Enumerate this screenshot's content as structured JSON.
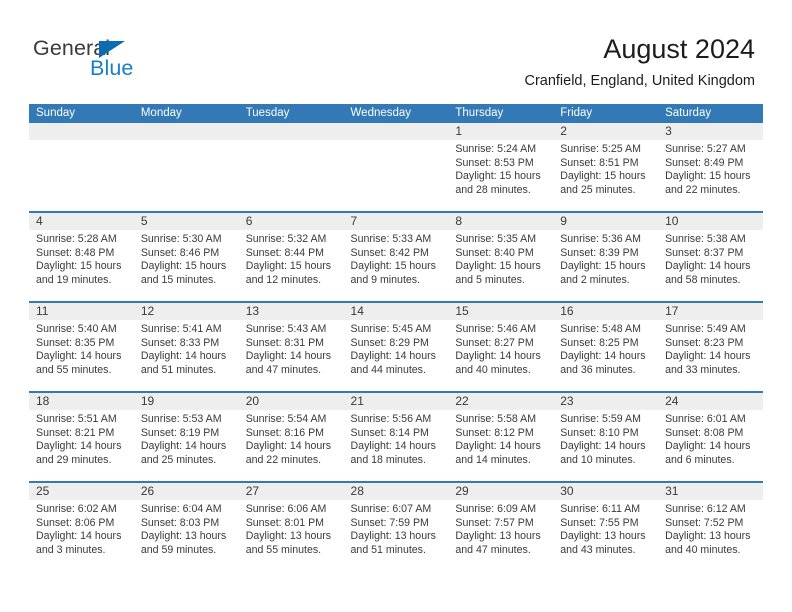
{
  "brand": {
    "name_part1": "General",
    "name_part2": "Blue",
    "triangle_color": "#0b6cb4",
    "blue_color": "#1a7ec8"
  },
  "header": {
    "title": "August 2024",
    "subtitle": "Cranfield, England, United Kingdom"
  },
  "theme": {
    "header_blue": "#3279b5",
    "daynum_band": "#eeeeee",
    "text": "#3a3a3a"
  },
  "weekdays": [
    "Sunday",
    "Monday",
    "Tuesday",
    "Wednesday",
    "Thursday",
    "Friday",
    "Saturday"
  ],
  "weeks": [
    {
      "days": [
        {
          "num": "",
          "sunrise": "",
          "sunset": "",
          "daylight_line1": "",
          "daylight_line2": ""
        },
        {
          "num": "",
          "sunrise": "",
          "sunset": "",
          "daylight_line1": "",
          "daylight_line2": ""
        },
        {
          "num": "",
          "sunrise": "",
          "sunset": "",
          "daylight_line1": "",
          "daylight_line2": ""
        },
        {
          "num": "",
          "sunrise": "",
          "sunset": "",
          "daylight_line1": "",
          "daylight_line2": ""
        },
        {
          "num": "1",
          "sunrise": "Sunrise: 5:24 AM",
          "sunset": "Sunset: 8:53 PM",
          "daylight_line1": "Daylight: 15 hours",
          "daylight_line2": "and 28 minutes."
        },
        {
          "num": "2",
          "sunrise": "Sunrise: 5:25 AM",
          "sunset": "Sunset: 8:51 PM",
          "daylight_line1": "Daylight: 15 hours",
          "daylight_line2": "and 25 minutes."
        },
        {
          "num": "3",
          "sunrise": "Sunrise: 5:27 AM",
          "sunset": "Sunset: 8:49 PM",
          "daylight_line1": "Daylight: 15 hours",
          "daylight_line2": "and 22 minutes."
        }
      ]
    },
    {
      "days": [
        {
          "num": "4",
          "sunrise": "Sunrise: 5:28 AM",
          "sunset": "Sunset: 8:48 PM",
          "daylight_line1": "Daylight: 15 hours",
          "daylight_line2": "and 19 minutes."
        },
        {
          "num": "5",
          "sunrise": "Sunrise: 5:30 AM",
          "sunset": "Sunset: 8:46 PM",
          "daylight_line1": "Daylight: 15 hours",
          "daylight_line2": "and 15 minutes."
        },
        {
          "num": "6",
          "sunrise": "Sunrise: 5:32 AM",
          "sunset": "Sunset: 8:44 PM",
          "daylight_line1": "Daylight: 15 hours",
          "daylight_line2": "and 12 minutes."
        },
        {
          "num": "7",
          "sunrise": "Sunrise: 5:33 AM",
          "sunset": "Sunset: 8:42 PM",
          "daylight_line1": "Daylight: 15 hours",
          "daylight_line2": "and 9 minutes."
        },
        {
          "num": "8",
          "sunrise": "Sunrise: 5:35 AM",
          "sunset": "Sunset: 8:40 PM",
          "daylight_line1": "Daylight: 15 hours",
          "daylight_line2": "and 5 minutes."
        },
        {
          "num": "9",
          "sunrise": "Sunrise: 5:36 AM",
          "sunset": "Sunset: 8:39 PM",
          "daylight_line1": "Daylight: 15 hours",
          "daylight_line2": "and 2 minutes."
        },
        {
          "num": "10",
          "sunrise": "Sunrise: 5:38 AM",
          "sunset": "Sunset: 8:37 PM",
          "daylight_line1": "Daylight: 14 hours",
          "daylight_line2": "and 58 minutes."
        }
      ]
    },
    {
      "days": [
        {
          "num": "11",
          "sunrise": "Sunrise: 5:40 AM",
          "sunset": "Sunset: 8:35 PM",
          "daylight_line1": "Daylight: 14 hours",
          "daylight_line2": "and 55 minutes."
        },
        {
          "num": "12",
          "sunrise": "Sunrise: 5:41 AM",
          "sunset": "Sunset: 8:33 PM",
          "daylight_line1": "Daylight: 14 hours",
          "daylight_line2": "and 51 minutes."
        },
        {
          "num": "13",
          "sunrise": "Sunrise: 5:43 AM",
          "sunset": "Sunset: 8:31 PM",
          "daylight_line1": "Daylight: 14 hours",
          "daylight_line2": "and 47 minutes."
        },
        {
          "num": "14",
          "sunrise": "Sunrise: 5:45 AM",
          "sunset": "Sunset: 8:29 PM",
          "daylight_line1": "Daylight: 14 hours",
          "daylight_line2": "and 44 minutes."
        },
        {
          "num": "15",
          "sunrise": "Sunrise: 5:46 AM",
          "sunset": "Sunset: 8:27 PM",
          "daylight_line1": "Daylight: 14 hours",
          "daylight_line2": "and 40 minutes."
        },
        {
          "num": "16",
          "sunrise": "Sunrise: 5:48 AM",
          "sunset": "Sunset: 8:25 PM",
          "daylight_line1": "Daylight: 14 hours",
          "daylight_line2": "and 36 minutes."
        },
        {
          "num": "17",
          "sunrise": "Sunrise: 5:49 AM",
          "sunset": "Sunset: 8:23 PM",
          "daylight_line1": "Daylight: 14 hours",
          "daylight_line2": "and 33 minutes."
        }
      ]
    },
    {
      "days": [
        {
          "num": "18",
          "sunrise": "Sunrise: 5:51 AM",
          "sunset": "Sunset: 8:21 PM",
          "daylight_line1": "Daylight: 14 hours",
          "daylight_line2": "and 29 minutes."
        },
        {
          "num": "19",
          "sunrise": "Sunrise: 5:53 AM",
          "sunset": "Sunset: 8:19 PM",
          "daylight_line1": "Daylight: 14 hours",
          "daylight_line2": "and 25 minutes."
        },
        {
          "num": "20",
          "sunrise": "Sunrise: 5:54 AM",
          "sunset": "Sunset: 8:16 PM",
          "daylight_line1": "Daylight: 14 hours",
          "daylight_line2": "and 22 minutes."
        },
        {
          "num": "21",
          "sunrise": "Sunrise: 5:56 AM",
          "sunset": "Sunset: 8:14 PM",
          "daylight_line1": "Daylight: 14 hours",
          "daylight_line2": "and 18 minutes."
        },
        {
          "num": "22",
          "sunrise": "Sunrise: 5:58 AM",
          "sunset": "Sunset: 8:12 PM",
          "daylight_line1": "Daylight: 14 hours",
          "daylight_line2": "and 14 minutes."
        },
        {
          "num": "23",
          "sunrise": "Sunrise: 5:59 AM",
          "sunset": "Sunset: 8:10 PM",
          "daylight_line1": "Daylight: 14 hours",
          "daylight_line2": "and 10 minutes."
        },
        {
          "num": "24",
          "sunrise": "Sunrise: 6:01 AM",
          "sunset": "Sunset: 8:08 PM",
          "daylight_line1": "Daylight: 14 hours",
          "daylight_line2": "and 6 minutes."
        }
      ]
    },
    {
      "days": [
        {
          "num": "25",
          "sunrise": "Sunrise: 6:02 AM",
          "sunset": "Sunset: 8:06 PM",
          "daylight_line1": "Daylight: 14 hours",
          "daylight_line2": "and 3 minutes."
        },
        {
          "num": "26",
          "sunrise": "Sunrise: 6:04 AM",
          "sunset": "Sunset: 8:03 PM",
          "daylight_line1": "Daylight: 13 hours",
          "daylight_line2": "and 59 minutes."
        },
        {
          "num": "27",
          "sunrise": "Sunrise: 6:06 AM",
          "sunset": "Sunset: 8:01 PM",
          "daylight_line1": "Daylight: 13 hours",
          "daylight_line2": "and 55 minutes."
        },
        {
          "num": "28",
          "sunrise": "Sunrise: 6:07 AM",
          "sunset": "Sunset: 7:59 PM",
          "daylight_line1": "Daylight: 13 hours",
          "daylight_line2": "and 51 minutes."
        },
        {
          "num": "29",
          "sunrise": "Sunrise: 6:09 AM",
          "sunset": "Sunset: 7:57 PM",
          "daylight_line1": "Daylight: 13 hours",
          "daylight_line2": "and 47 minutes."
        },
        {
          "num": "30",
          "sunrise": "Sunrise: 6:11 AM",
          "sunset": "Sunset: 7:55 PM",
          "daylight_line1": "Daylight: 13 hours",
          "daylight_line2": "and 43 minutes."
        },
        {
          "num": "31",
          "sunrise": "Sunrise: 6:12 AM",
          "sunset": "Sunset: 7:52 PM",
          "daylight_line1": "Daylight: 13 hours",
          "daylight_line2": "and 40 minutes."
        }
      ]
    }
  ]
}
